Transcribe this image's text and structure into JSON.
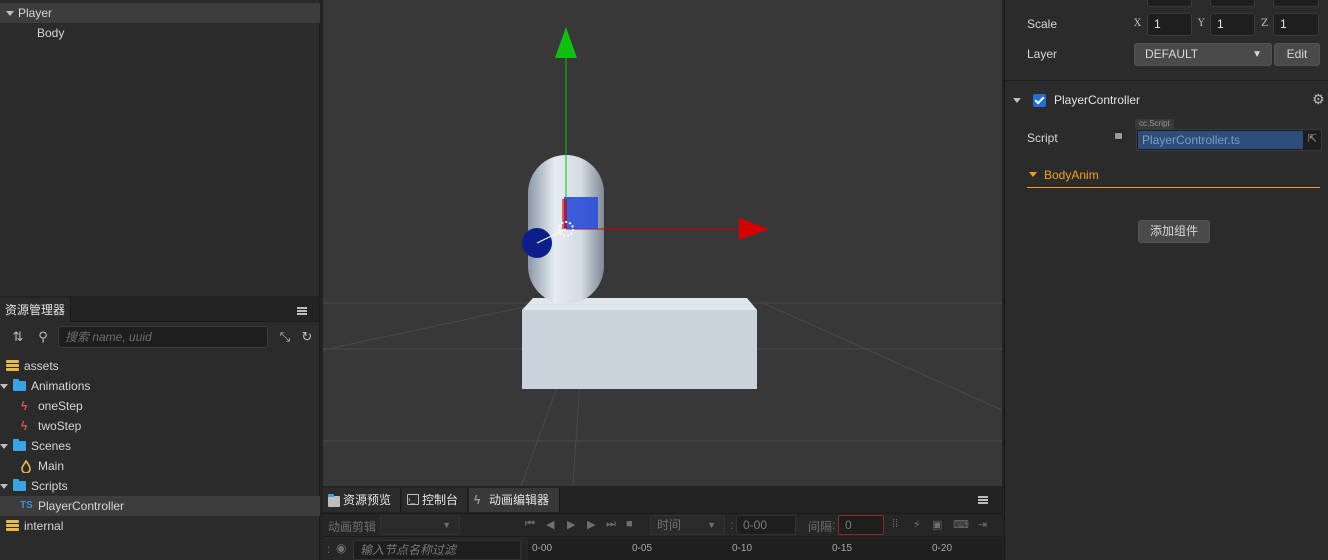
{
  "hierarchy": {
    "nodes": [
      {
        "label": "Player",
        "expanded": true
      },
      {
        "label": "Body"
      }
    ]
  },
  "assets_panel": {
    "title": "资源管理器",
    "search_placeholder": "搜索 name, uuid",
    "items": [
      {
        "label": "assets",
        "icon": "database-icon"
      },
      {
        "label": "Animations",
        "icon": "folder-icon",
        "expanded": true
      },
      {
        "label": "oneStep",
        "icon": "animation-clip-icon"
      },
      {
        "label": "twoStep",
        "icon": "animation-clip-icon"
      },
      {
        "label": "Scenes",
        "icon": "folder-icon",
        "expanded": true
      },
      {
        "label": "Main",
        "icon": "scene-icon"
      },
      {
        "label": "Scripts",
        "icon": "folder-icon",
        "expanded": true
      },
      {
        "label": "PlayerController",
        "icon": "typescript-icon",
        "icon_text": "TS",
        "selected": true
      },
      {
        "label": "internal",
        "icon": "database-icon"
      }
    ]
  },
  "bottom_panel": {
    "tabs": [
      {
        "label": "资源预览",
        "icon": "folder-icon"
      },
      {
        "label": "控制台",
        "icon": "console-icon"
      },
      {
        "label": "动画编辑器",
        "icon": "animation-icon",
        "active": true
      }
    ],
    "clip_label": "动画剪辑",
    "time_label": "时间",
    "time_value": "0-00",
    "interval_label": "间隔",
    "interval_value": "0",
    "node_filter_placeholder": "输入节点名称过滤",
    "timeline_ticks": [
      "0-00",
      "0-05",
      "0-10",
      "0-15",
      "0-20"
    ]
  },
  "inspector": {
    "scale_label": "Scale",
    "scale": {
      "x_label": "X",
      "x": "1",
      "y_label": "Y",
      "y": "1",
      "z_label": "Z",
      "z": "1"
    },
    "layer_label": "Layer",
    "layer_value": "DEFAULT",
    "edit_button": "Edit",
    "component_name": "PlayerController",
    "component_enabled": true,
    "script_label": "Script",
    "script_tag": "cc.Script",
    "script_value": "PlayerController.ts",
    "subsection_label": "BodyAnim",
    "add_component_button": "添加组件"
  },
  "colors": {
    "accent_orange": "#f0a020",
    "selection_blue": "#2f4d7a",
    "gizmo_x": "#d40000",
    "gizmo_y": "#10c010",
    "gizmo_plane": "#2a4dd8"
  }
}
